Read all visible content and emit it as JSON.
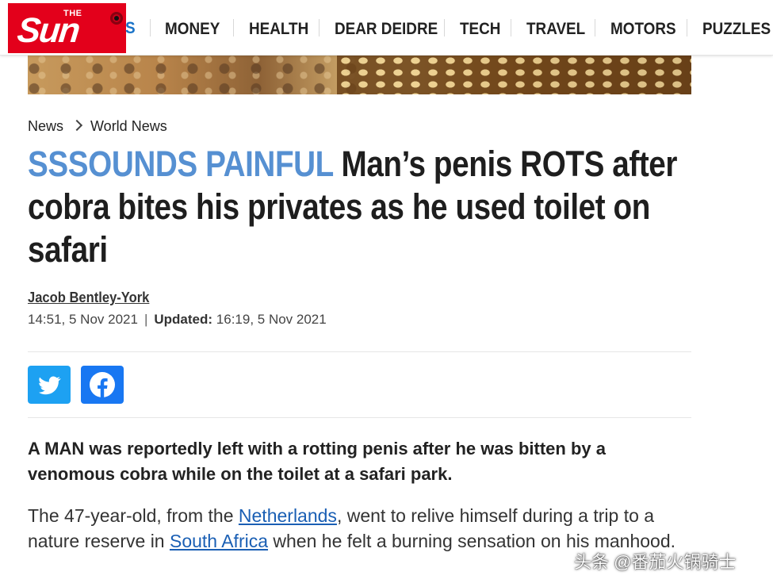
{
  "brand": {
    "the_label": "THE",
    "name": "Sun",
    "color": "#e3001b"
  },
  "nav": {
    "partial_item": "S",
    "items": [
      "MONEY",
      "HEALTH",
      "DEAR DEIDRE",
      "TECH",
      "TRAVEL",
      "MOTORS",
      "PUZZLES"
    ]
  },
  "breadcrumb": {
    "section": "News",
    "subsection": "World News"
  },
  "article": {
    "kicker": "SSSOUNDS PAINFUL",
    "headline": "Man’s penis ROTS after cobra bites his privates as he used toilet on safari",
    "author": "Jacob Bentley-York",
    "published": "14:51, 5 Nov 2021",
    "updated_label": "Updated:",
    "updated": "16:19, 5 Nov 2021",
    "standfirst": "A MAN was reportedly left with a rotting penis after he was bitten by a venomous cobra while on the toilet at a safari park.",
    "para1_a": "The 47-year-old, from the ",
    "link_netherlands": "Netherlands",
    "para1_b": ", went to relive himself during a trip to a nature reserve in ",
    "link_south_africa": "South Africa",
    "para1_c": " when he felt a burning sensation on his manhood."
  },
  "share": {
    "twitter_icon": "twitter-icon",
    "facebook_icon": "facebook-icon",
    "twitter_color": "#1da1f2",
    "facebook_color": "#1877f2"
  },
  "colors": {
    "kicker": "#5690d2",
    "link": "#1a5fb4"
  },
  "watermark": "头条 @番茄火锅骑士"
}
